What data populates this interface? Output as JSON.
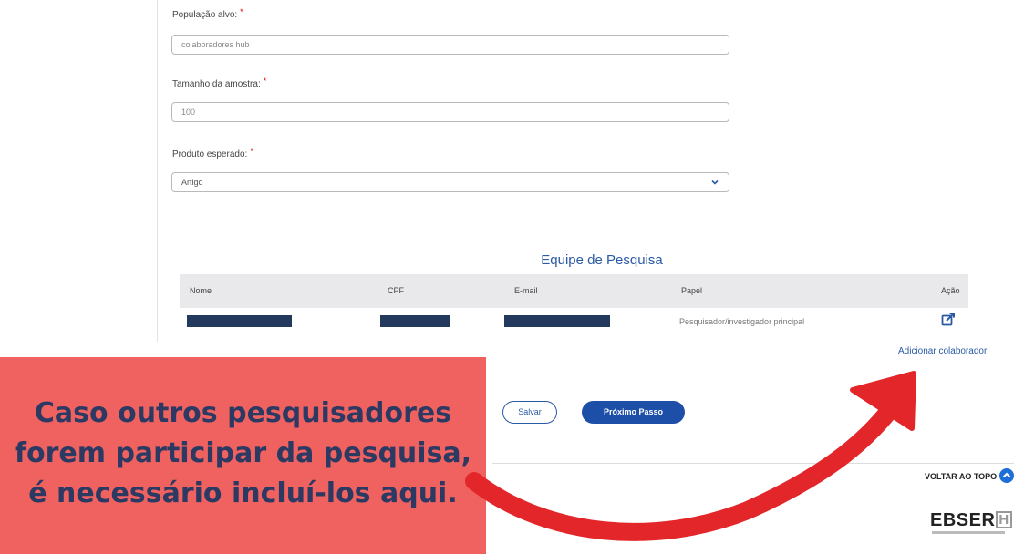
{
  "form": {
    "populacao": {
      "label": "População alvo:",
      "required": "*",
      "value": "colaboradores hub"
    },
    "amostra": {
      "label": "Tamanho da amostra:",
      "required": "*",
      "value": "100"
    },
    "produto": {
      "label": "Produto esperado:",
      "required": "*",
      "selected": "Artigo"
    }
  },
  "team": {
    "title": "Equipe de Pesquisa",
    "columns": [
      "Nome",
      "CPF",
      "E-mail",
      "Papel",
      "Ação"
    ],
    "rows": [
      {
        "papel": "Pesquisador/investigador principal",
        "action_icon": "edit-icon"
      }
    ],
    "add_link": "Adicionar colaborador"
  },
  "actions": {
    "save": "Salvar",
    "next": "Próximo Passo"
  },
  "footer": {
    "back_to_top": "VOLTAR AO TOPO",
    "logo": "EBSER",
    "logo_mark": "H"
  },
  "callout": {
    "lines": [
      "Caso outros pesquisadores",
      "forem participar da pesquisa,",
      "é necessário incluí-los aqui."
    ],
    "background": "#f0625f",
    "text_color": "#2c3a63"
  },
  "colors": {
    "primary": "#1e4fa8",
    "link": "#2a5aa4",
    "arrow": "#e3262a",
    "redaction": "#233a5e"
  }
}
